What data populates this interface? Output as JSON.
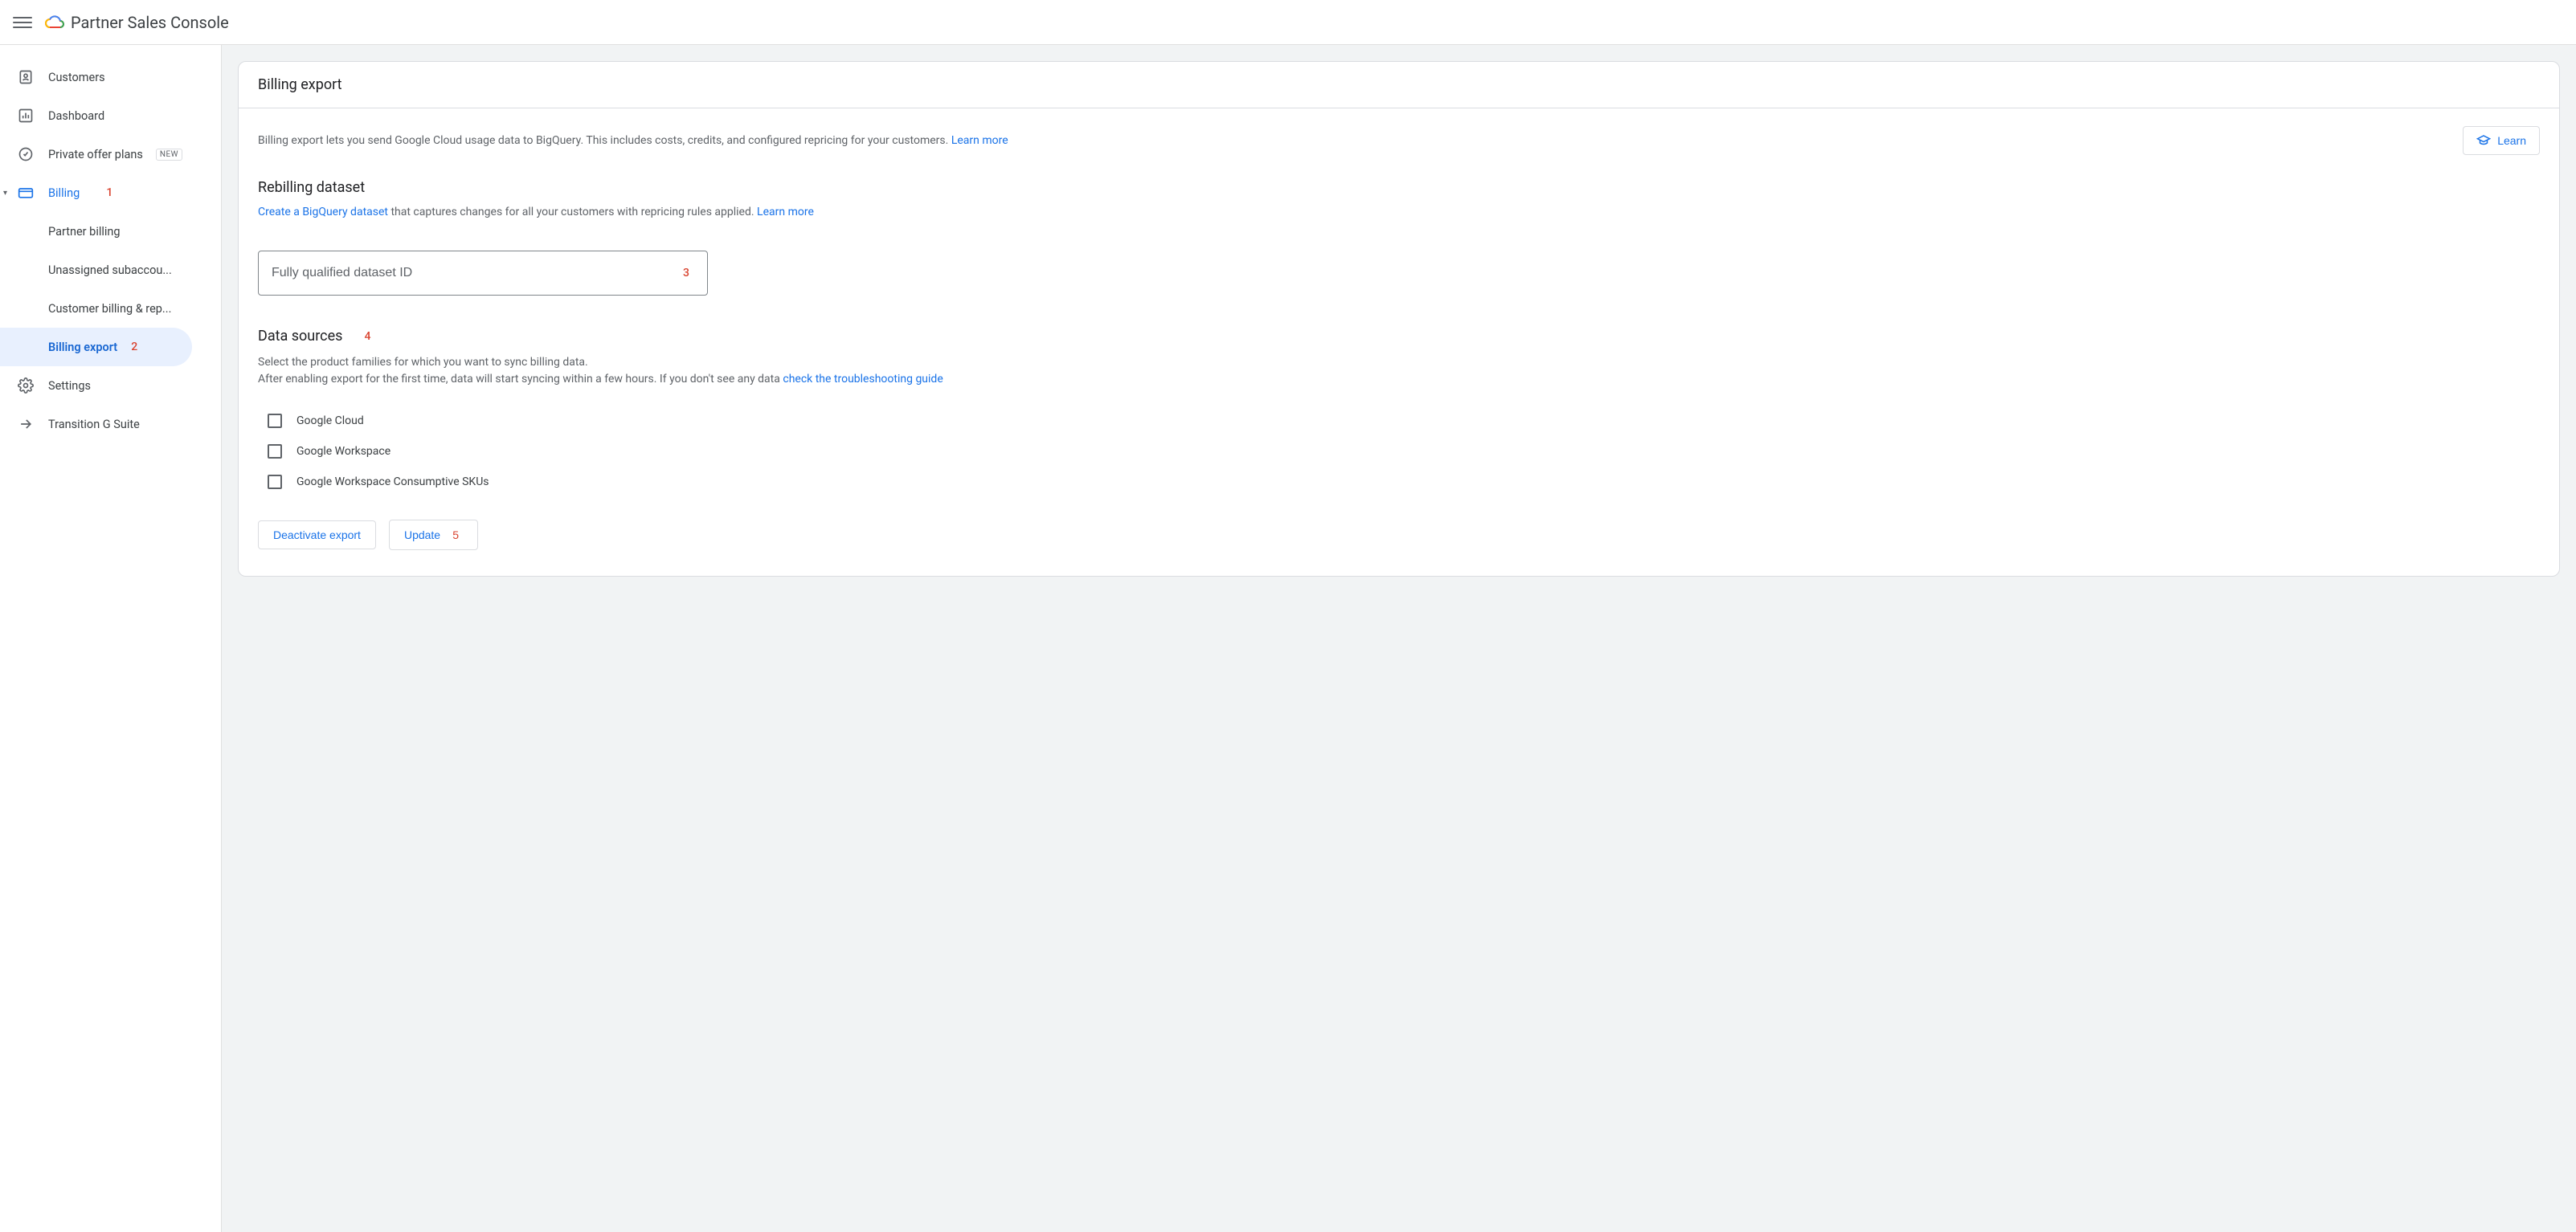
{
  "header": {
    "app_title": "Partner Sales Console"
  },
  "sidebar": {
    "items": [
      {
        "label": "Customers"
      },
      {
        "label": "Dashboard"
      },
      {
        "label": "Private offer plans",
        "badge": "NEW"
      },
      {
        "label": "Billing",
        "annotation": "1"
      },
      {
        "label": "Settings"
      },
      {
        "label": "Transition G Suite"
      }
    ],
    "billing_children": [
      {
        "label": "Partner billing"
      },
      {
        "label": "Unassigned subaccou..."
      },
      {
        "label": "Customer billing & rep..."
      },
      {
        "label": "Billing export",
        "annotation": "2"
      }
    ]
  },
  "main": {
    "title": "Billing export",
    "intro_text": "Billing export lets you send Google Cloud usage data to BigQuery. This includes costs, credits, and configured repricing for your customers. ",
    "intro_learn_more": "Learn more",
    "learn_button": "Learn",
    "rebilling": {
      "heading": "Rebilling dataset",
      "create_link": "Create a BigQuery dataset",
      "desc_rest": " that captures changes for all your customers with repricing rules applied. ",
      "learn_more": "Learn more",
      "input_placeholder": "Fully qualified dataset ID",
      "input_annotation": "3"
    },
    "data_sources": {
      "heading": "Data sources",
      "heading_annotation": "4",
      "line1": "Select the product families for which you want to sync billing data.",
      "line2_a": "After enabling export for the first time, data will start syncing within a few hours. If you don't see any data ",
      "line2_link": "check the troubleshooting guide",
      "options": [
        {
          "label": "Google Cloud"
        },
        {
          "label": "Google Workspace"
        },
        {
          "label": "Google Workspace Consumptive SKUs"
        }
      ]
    },
    "actions": {
      "deactivate": "Deactivate export",
      "update": "Update",
      "update_annotation": "5"
    }
  }
}
